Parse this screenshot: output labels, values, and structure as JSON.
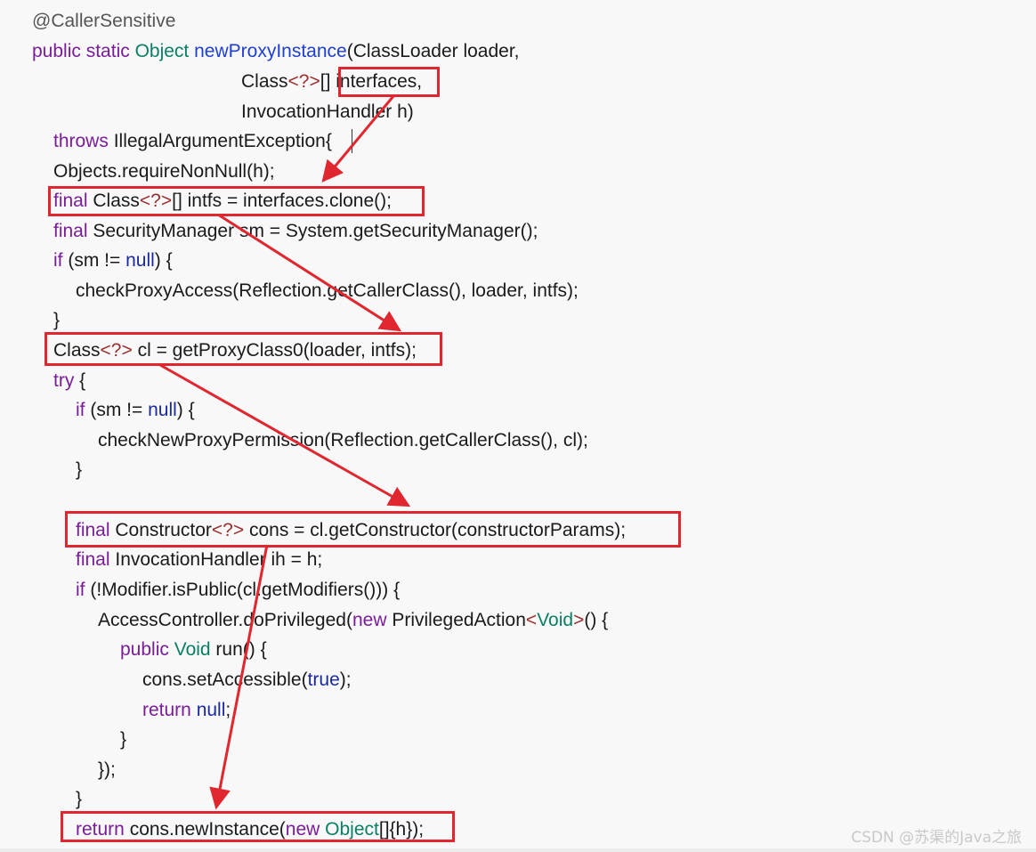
{
  "code": {
    "lines": [
      [
        {
          "t": "@CallerSensitive",
          "c": "ann"
        }
      ],
      [
        {
          "t": "public",
          "c": "kw"
        },
        {
          "t": " ",
          "c": "plain"
        },
        {
          "t": "static",
          "c": "kw"
        },
        {
          "t": " ",
          "c": "plain"
        },
        {
          "t": "Object",
          "c": "type"
        },
        {
          "t": " ",
          "c": "plain"
        },
        {
          "t": "newProxyInstance",
          "c": "fn"
        },
        {
          "t": "(ClassLoader loader,",
          "c": "plain"
        }
      ],
      [
        {
          "t": "Class",
          "c": "plain"
        },
        {
          "t": "<?>",
          "c": "gen"
        },
        {
          "t": "[] interfaces,",
          "c": "plain"
        }
      ],
      [
        {
          "t": "InvocationHandler h)",
          "c": "plain"
        }
      ],
      [
        {
          "t": "throws",
          "c": "kw"
        },
        {
          "t": " IllegalArgumentException{",
          "c": "plain"
        }
      ],
      [
        {
          "t": "Objects.requireNonNull(h);",
          "c": "plain"
        }
      ],
      [
        {
          "t": "final",
          "c": "kw"
        },
        {
          "t": " Class",
          "c": "plain"
        },
        {
          "t": "<?>",
          "c": "gen"
        },
        {
          "t": "[] intfs = interfaces.clone();",
          "c": "plain"
        }
      ],
      [
        {
          "t": "final",
          "c": "kw"
        },
        {
          "t": " SecurityManager sm = System.getSecurityManager();",
          "c": "plain"
        }
      ],
      [
        {
          "t": "if",
          "c": "kw"
        },
        {
          "t": " (sm != ",
          "c": "plain"
        },
        {
          "t": "null",
          "c": "lit"
        },
        {
          "t": ") {",
          "c": "plain"
        }
      ],
      [
        {
          "t": "checkProxyAccess(Reflection.getCallerClass(), loader, intfs);",
          "c": "plain"
        }
      ],
      [
        {
          "t": "}",
          "c": "plain"
        }
      ],
      [
        {
          "t": "Class",
          "c": "plain"
        },
        {
          "t": "<?>",
          "c": "gen"
        },
        {
          "t": " cl = getProxyClass0(loader, intfs);",
          "c": "plain"
        }
      ],
      [
        {
          "t": "try",
          "c": "kw"
        },
        {
          "t": " {",
          "c": "plain"
        }
      ],
      [
        {
          "t": "if",
          "c": "kw"
        },
        {
          "t": " (sm != ",
          "c": "plain"
        },
        {
          "t": "null",
          "c": "lit"
        },
        {
          "t": ") {",
          "c": "plain"
        }
      ],
      [
        {
          "t": "checkNewProxyPermission(Reflection.getCallerClass(), cl);",
          "c": "plain"
        }
      ],
      [
        {
          "t": "}",
          "c": "plain"
        }
      ],
      [],
      [
        {
          "t": "final",
          "c": "kw"
        },
        {
          "t": " Constructor",
          "c": "plain"
        },
        {
          "t": "<?>",
          "c": "gen"
        },
        {
          "t": " cons = cl.getConstructor(constructorParams);",
          "c": "plain"
        }
      ],
      [
        {
          "t": "final",
          "c": "kw"
        },
        {
          "t": " InvocationHandler ih = h;",
          "c": "plain"
        }
      ],
      [
        {
          "t": "if",
          "c": "kw"
        },
        {
          "t": " (!Modifier.isPublic(cl.getModifiers())) {",
          "c": "plain"
        }
      ],
      [
        {
          "t": "AccessController.doPrivileged(",
          "c": "plain"
        },
        {
          "t": "new",
          "c": "kw"
        },
        {
          "t": " PrivilegedAction",
          "c": "plain"
        },
        {
          "t": "<",
          "c": "gen"
        },
        {
          "t": "Void",
          "c": "type"
        },
        {
          "t": ">",
          "c": "gen"
        },
        {
          "t": "() {",
          "c": "plain"
        }
      ],
      [
        {
          "t": "public",
          "c": "kw"
        },
        {
          "t": " ",
          "c": "plain"
        },
        {
          "t": "Void",
          "c": "type"
        },
        {
          "t": " run() {",
          "c": "plain"
        }
      ],
      [
        {
          "t": "cons.setAccessible(",
          "c": "plain"
        },
        {
          "t": "true",
          "c": "lit"
        },
        {
          "t": ");",
          "c": "plain"
        }
      ],
      [
        {
          "t": "return",
          "c": "kw"
        },
        {
          "t": " ",
          "c": "plain"
        },
        {
          "t": "null",
          "c": "lit"
        },
        {
          "t": ";",
          "c": "plain"
        }
      ],
      [
        {
          "t": "}",
          "c": "plain"
        }
      ],
      [
        {
          "t": "});",
          "c": "plain"
        }
      ],
      [
        {
          "t": "}",
          "c": "plain"
        }
      ],
      [
        {
          "t": "return",
          "c": "kw"
        },
        {
          "t": " cons.newInstance(",
          "c": "plain"
        },
        {
          "t": "new",
          "c": "kw"
        },
        {
          "t": " ",
          "c": "plain"
        },
        {
          "t": "Object",
          "c": "type"
        },
        {
          "t": "[]{h});",
          "c": "plain"
        }
      ]
    ]
  },
  "watermark": "CSDN @苏渠的Java之旅",
  "colors": {
    "annotation": "#555555",
    "keyword": "#7a1d99",
    "type": "#0a7f64",
    "method": "#1f3fd1",
    "literal": "#1a2aa0",
    "generic": "#9a2e2e",
    "highlight": "#e0262e"
  }
}
